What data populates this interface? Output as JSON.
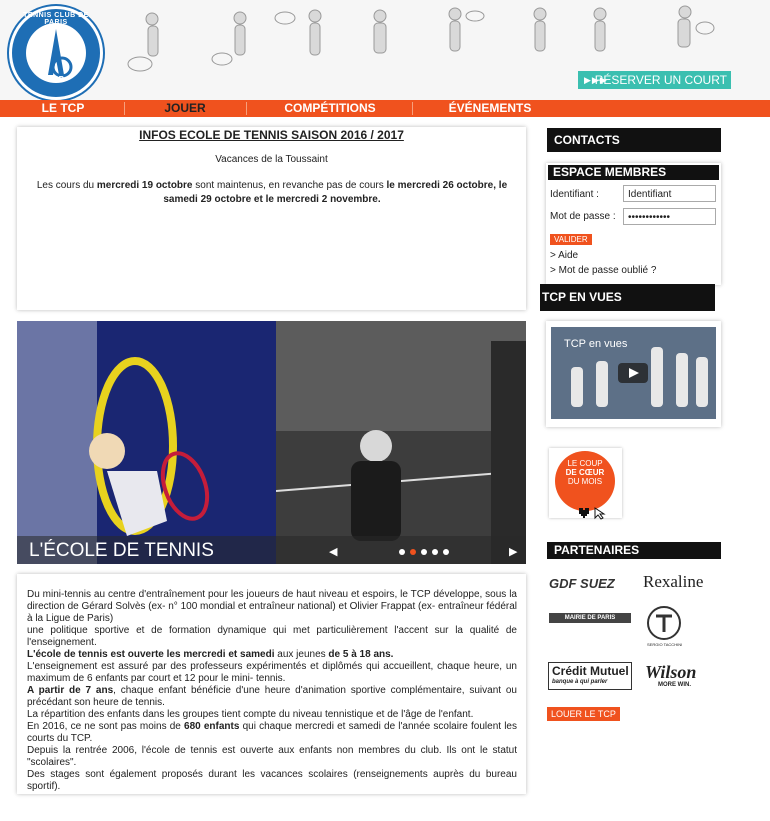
{
  "header": {
    "logo_text": "TENNIS CLUB DE PARIS",
    "logo_abbr": "TCP",
    "reserve_arrows": "▶▶▶",
    "reserve_label": "RÉSERVER UN COURT"
  },
  "nav": {
    "items": [
      "LE TCP",
      "JOUER",
      "COMPÉTITIONS",
      "ÉVÉNEMENTS"
    ]
  },
  "info": {
    "title": "INFOS ECOLE DE TENNIS SAISON 2016 / 2017",
    "subtitle": "Vacances de la Toussaint",
    "body_part1": "Les cours du ",
    "body_bold1": "mercredi 19 octobre",
    "body_part2": " sont maintenus, en revanche pas de cours ",
    "body_bold2": "le mercredi 26 octobre, le samedi 29 octobre et le mercredi 2 novembre."
  },
  "slider": {
    "caption": "L'ÉCOLE DE TENNIS",
    "prev_icon": "◀",
    "next_icon": "▶",
    "dot_count": 5,
    "active_dot": 1
  },
  "text": {
    "p1": "Du mini-tennis au centre d'entraînement pour les joueurs de haut niveau et espoirs, le TCP développe, sous la direction de Gérard Solvès (ex- n° 100 mondial et entraîneur national) et Olivier Frappat (ex- entraîneur fédéral à la Ligue de Paris)",
    "p2": "une politique sportive et de formation dynamique qui met particulièrement l'accent sur la qualité de l'enseignement.",
    "p3_bold": "L'école de tennis est ouverte les mercredi et samedi",
    "p3_mid": " aux jeunes ",
    "p3_bold2": "de 5 à 18 ans.",
    "p4": "L'enseignement est assuré par des professeurs expérimentés et diplômés qui accueillent, chaque heure, un maximum de 6 enfants par court et 12 pour le mini- tennis.",
    "p5_bold": "A partir de 7 ans",
    "p5_rest": ", chaque enfant bénéficie d'une heure d'animation sportive complémentaire, suivant ou précédant son heure de tennis.",
    "p6": "La répartition des enfants dans les groupes tient compte du niveau tennistique et de l'âge de l'enfant.",
    "p7_start": "En 2016, ce ne sont pas moins de ",
    "p7_bold": "680 enfants",
    "p7_rest": " qui chaque mercredi et samedi de l'année scolaire foulent les courts du TCP.",
    "p8": "Depuis la rentrée 2006, l'école de tennis est ouverte aux enfants non membres du club. Ils ont le statut \"scolaires\".",
    "p9": "Des stages sont également proposés durant les vacances scolaires (renseignements auprès du bureau sportif)."
  },
  "sidebar": {
    "contacts": "CONTACTS",
    "membres_title": "ESPACE MEMBRES",
    "login_label": "Identifiant :",
    "login_value": "Identifiant",
    "password_label": "Mot de passe :",
    "password_value": "••••••••••••",
    "submit": "VALIDER",
    "help_link": "> Aide",
    "forgot_link": "> Mot de passe oublié ?",
    "tcp_en_vues": "TCP EN VUES",
    "video_title": "TCP en vues",
    "coup_line1": "LE COUP",
    "coup_line2": "DE CŒUR",
    "coup_line3": "DU MOIS",
    "partenaires": "PARTENAIRES",
    "partners": [
      "GDF SUEZ",
      "Rexaline",
      "MAIRIE DE PARIS",
      "SERGIO TACCHINI",
      "Crédit Mutuel",
      "banque à qui parler",
      "Wilson",
      "MORE WIN."
    ],
    "louer": "LOUER LE TCP"
  }
}
